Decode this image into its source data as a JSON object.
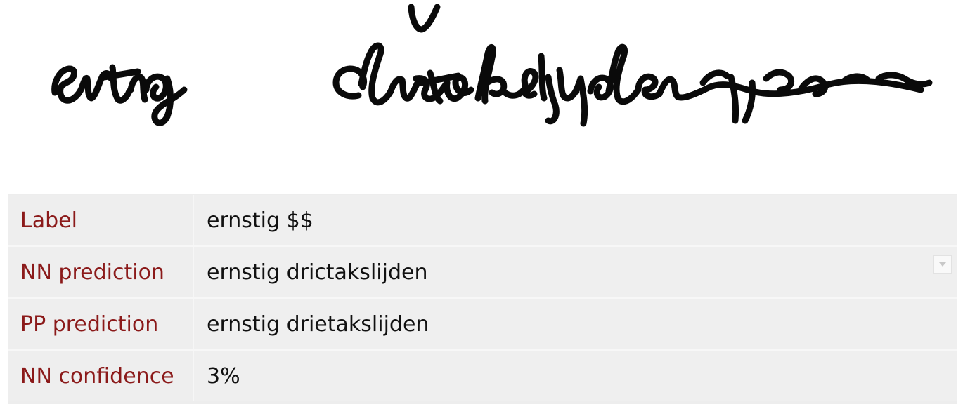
{
  "handwriting_image": {
    "icon": "handwritten-text-image"
  },
  "results": {
    "rows": [
      {
        "label": "Label",
        "value": "ernstig $$"
      },
      {
        "label": "NN prediction",
        "value": "ernstig drictakslijden"
      },
      {
        "label": "PP prediction",
        "value": "ernstig drietakslijden"
      },
      {
        "label": "NN confidence",
        "value": "3%"
      }
    ],
    "dropdown_icon": "chevron-down-icon"
  },
  "colors": {
    "label_text": "#8b1a1a",
    "value_text": "#111111",
    "table_bg": "#ededed",
    "ink": "#000000"
  }
}
